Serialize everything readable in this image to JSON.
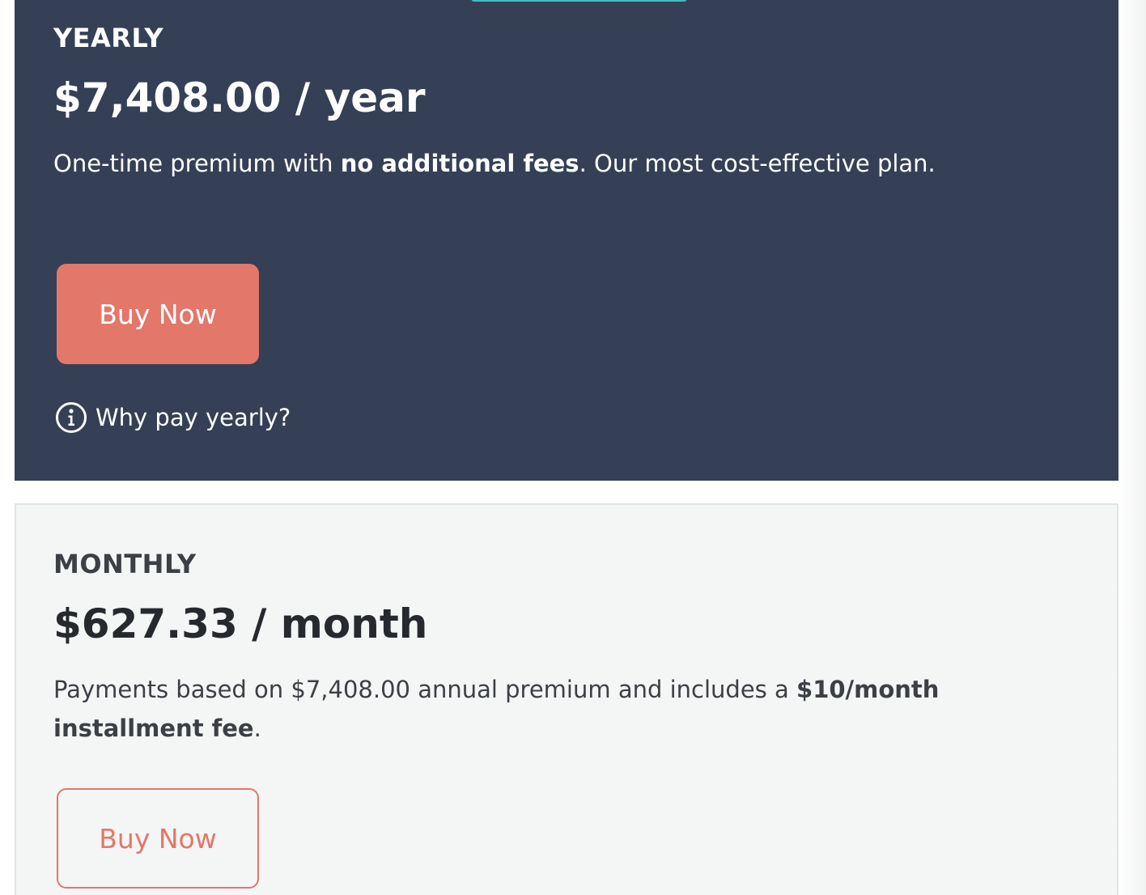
{
  "yearly": {
    "label": "YEARLY",
    "price": "$7,408.00 / year",
    "desc_pre": "One-time premium with ",
    "desc_bold": "no additional fees",
    "desc_post": ". Our most cost-effective plan.",
    "button_label": "Buy Now",
    "why_link": "Why pay yearly?",
    "info_icon": "info-circle-icon"
  },
  "monthly": {
    "label": "MONTHLY",
    "price": "$627.33 / month",
    "desc_pre": "Payments based on $7,408.00 annual premium and includes a ",
    "desc_bold": "$10/month installment fee",
    "desc_post": ".",
    "button_label": "Buy Now"
  },
  "colors": {
    "yearly_bg": "#354056",
    "monthly_bg": "#f4f5f5",
    "accent": "#e3776a",
    "tab_accent": "#4bb9bf"
  }
}
